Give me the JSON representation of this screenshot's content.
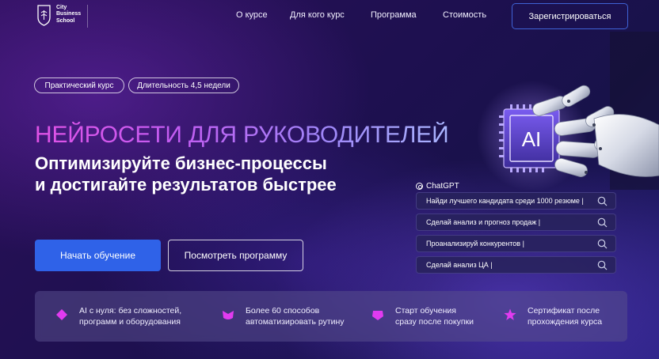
{
  "header": {
    "logo": {
      "line1": "City",
      "line2": "Business",
      "line3": "School"
    },
    "nav": [
      {
        "label": "О курсе"
      },
      {
        "label": "Для кого курс"
      },
      {
        "label": "Программа"
      },
      {
        "label": "Стоимость"
      }
    ],
    "register_label": "Зарегистрироваться"
  },
  "hero": {
    "badges": [
      "Практический курс",
      "Длительность 4,5 недели"
    ],
    "headline": "НЕЙРОСЕТИ ДЛЯ РУКОВОДИТЕЛЕЙ",
    "subhead_line1": "Оптимизируйте бизнес-процессы",
    "subhead_line2": "и достигайте результатов быстрее",
    "primary_button": "Начать обучение",
    "secondary_button": "Посмотреть программу",
    "chip_label": "AI"
  },
  "chatgpt": {
    "label": "ChatGPT",
    "prompts": [
      "Найди лучшего кандидата среди 1000 резюме |",
      "Сделай анализ и прогноз продаж |",
      "Проанализируй конкурентов |",
      "Сделай  анализ ЦА |"
    ]
  },
  "features": [
    {
      "line1": "AI с нуля: без сложностей,",
      "line2": "программ и оборудования",
      "icon": "diamond-icon"
    },
    {
      "line1": "Более 60 способов",
      "line2": "автоматизировать рутину",
      "icon": "crown-icon"
    },
    {
      "line1": "Старт обучения",
      "line2": "сразу после покупки",
      "icon": "pentagon-icon"
    },
    {
      "line1": "Сертификат после",
      "line2": "прохождения курса",
      "icon": "star-icon"
    }
  ],
  "colors": {
    "accent": "#2f62e8",
    "feature_icon": "#e13bf0",
    "headline_start": "#e052e6",
    "headline_end": "#aab6ff"
  }
}
